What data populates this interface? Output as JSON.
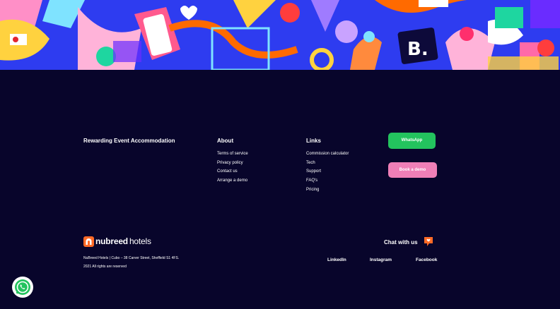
{
  "footer": {
    "tagline": "Rewarding Event Accommodation",
    "about": {
      "title": "About",
      "links": [
        "Terms of service",
        "Privacy policy",
        "Contact us",
        "Arrange a demo"
      ]
    },
    "links": {
      "title": "Links",
      "items": [
        "Commission calculator",
        "Tech",
        "Support",
        "FAQ's",
        "Pricing"
      ]
    },
    "buttons": {
      "whatsapp": "WhatsApp",
      "book_demo": "Book a demo"
    },
    "logo": {
      "bold": "nubreed",
      "thin": "hotels"
    },
    "address": "NuBreed Hotels | Cubo – 38 Carver Street, Sheffield S1 4FS.",
    "rights": "2021 All rights are reserved",
    "chat_label": "Chat with us",
    "social": [
      "LinkedIn",
      "Instagram",
      "Facebook"
    ]
  },
  "banner": {
    "letter": "B."
  },
  "colors": {
    "background": "#08052b",
    "whatsapp_green": "#23c35e",
    "demo_pink": "#ef7fb7",
    "brand_orange": "#ff6a26",
    "banner_blue": "#2e3cf0"
  },
  "icons": [
    "whatsapp-icon",
    "chat-bubble-icon",
    "nubreed-logo-icon",
    "heart-icon"
  ]
}
